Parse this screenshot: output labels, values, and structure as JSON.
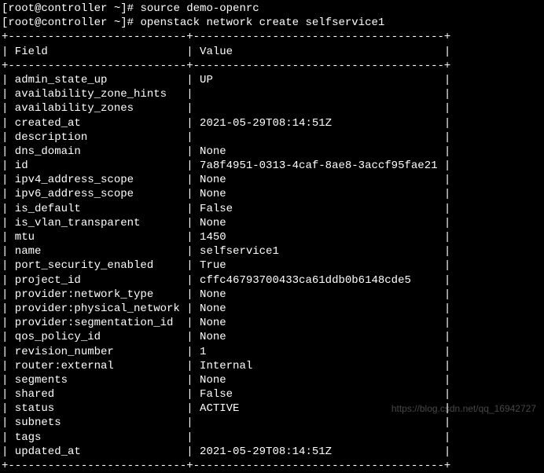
{
  "prompt1": "[root@controller ~]# ",
  "cmd1": "source demo-openrc",
  "prompt2": "[root@controller ~]# ",
  "cmd2": "openstack network create selfservice1",
  "border_top": "+---------------------------+--------------------------------------+",
  "header_row": "| Field                     | Value                                |",
  "border_mid": "+---------------------------+--------------------------------------+",
  "rows": [
    {
      "field": "admin_state_up",
      "value": "UP"
    },
    {
      "field": "availability_zone_hints",
      "value": ""
    },
    {
      "field": "availability_zones",
      "value": ""
    },
    {
      "field": "created_at",
      "value": "2021-05-29T08:14:51Z"
    },
    {
      "field": "description",
      "value": ""
    },
    {
      "field": "dns_domain",
      "value": "None"
    },
    {
      "field": "id",
      "value": "7a8f4951-0313-4caf-8ae8-3accf95fae21"
    },
    {
      "field": "ipv4_address_scope",
      "value": "None"
    },
    {
      "field": "ipv6_address_scope",
      "value": "None"
    },
    {
      "field": "is_default",
      "value": "False"
    },
    {
      "field": "is_vlan_transparent",
      "value": "None"
    },
    {
      "field": "mtu",
      "value": "1450"
    },
    {
      "field": "name",
      "value": "selfservice1"
    },
    {
      "field": "port_security_enabled",
      "value": "True"
    },
    {
      "field": "project_id",
      "value": "cffc46793700433ca61ddb0b6148cde5"
    },
    {
      "field": "provider:network_type",
      "value": "None"
    },
    {
      "field": "provider:physical_network",
      "value": "None"
    },
    {
      "field": "provider:segmentation_id",
      "value": "None"
    },
    {
      "field": "qos_policy_id",
      "value": "None"
    },
    {
      "field": "revision_number",
      "value": "1"
    },
    {
      "field": "router:external",
      "value": "Internal"
    },
    {
      "field": "segments",
      "value": "None"
    },
    {
      "field": "shared",
      "value": "False"
    },
    {
      "field": "status",
      "value": "ACTIVE"
    },
    {
      "field": "subnets",
      "value": ""
    },
    {
      "field": "tags",
      "value": ""
    },
    {
      "field": "updated_at",
      "value": "2021-05-29T08:14:51Z"
    }
  ],
  "border_bot": "+---------------------------+--------------------------------------+",
  "col1_width": 25,
  "col2_width": 36,
  "watermark": "https://blog.csdn.net/qq_16942727"
}
